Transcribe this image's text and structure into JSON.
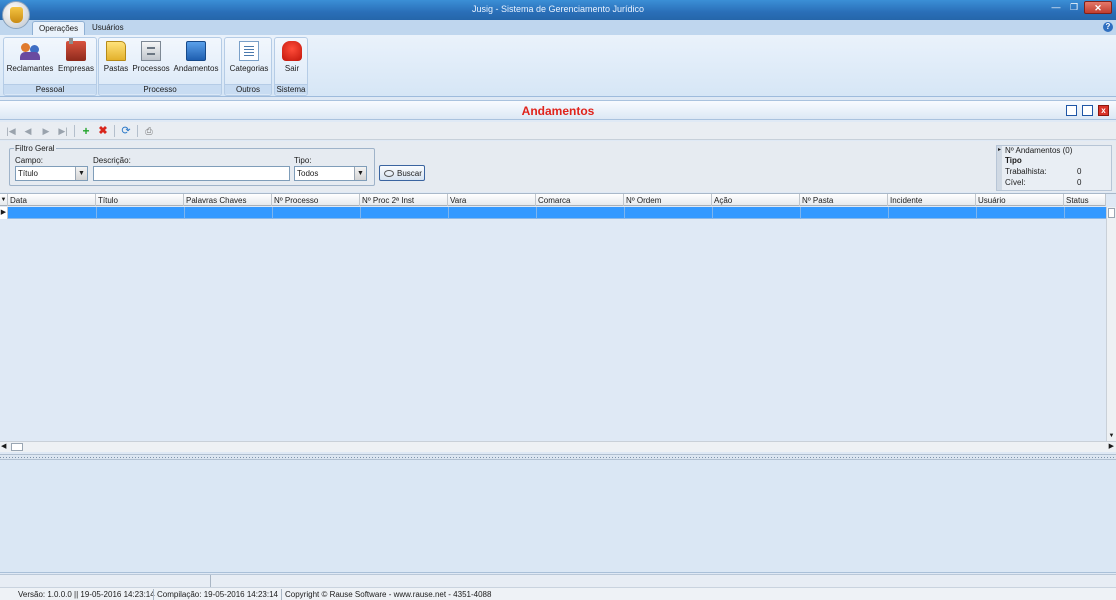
{
  "window": {
    "title": "Jusig - Sistema de Gerenciamento Jurídico",
    "controls": [
      "—",
      "❐",
      "✕"
    ]
  },
  "ribbon": {
    "tabs": [
      {
        "label": "Operações",
        "active": true
      },
      {
        "label": "Usuários",
        "active": false
      }
    ],
    "help_icon": "?",
    "groups": [
      {
        "label": "Pessoal",
        "buttons": [
          {
            "label": "Reclamantes",
            "icon": "people-icon"
          },
          {
            "label": "Empresas",
            "icon": "factory-icon"
          }
        ]
      },
      {
        "label": "Processo",
        "buttons": [
          {
            "label": "Pastas",
            "icon": "folder-icon"
          },
          {
            "label": "Processos",
            "icon": "cabinet-icon"
          },
          {
            "label": "Andamentos",
            "icon": "box-icon"
          }
        ]
      },
      {
        "label": "Outros",
        "buttons": [
          {
            "label": "Categorias",
            "icon": "list-icon"
          }
        ]
      },
      {
        "label": "Sistema",
        "buttons": [
          {
            "label": "Sair",
            "icon": "stop-hand-icon"
          }
        ]
      }
    ]
  },
  "document": {
    "title": "Andamentos",
    "title_color": "#e0231b",
    "close_glyph": "x"
  },
  "toolbar": {
    "first": "|◀",
    "prev": "◀",
    "next": "▶",
    "last": "▶|",
    "add": "+",
    "delete": "✖",
    "refresh": "⟳",
    "print": "⎙"
  },
  "filter": {
    "legend": "Filtro Geral",
    "campo_label": "Campo:",
    "campo_value": "Título",
    "descricao_label": "Descrição:",
    "descricao_value": "",
    "tipo_label": "Tipo:",
    "tipo_value": "Todos",
    "buscar_label": "Buscar"
  },
  "summary": {
    "legend": "Nº Andamentos (0)",
    "tipo_header": "Tipo",
    "rows": [
      {
        "label": "Trabalhista:",
        "value": "0"
      },
      {
        "label": "Cível:",
        "value": "0"
      }
    ]
  },
  "grid": {
    "columns": [
      "Data",
      "Título",
      "Palavras Chaves",
      "Nº Processo",
      "Nº Proc 2ª Inst",
      "Vara",
      "Comarca",
      "Nº Ordem",
      "Ação",
      "Nº Pasta",
      "Incidente",
      "Usuário",
      "Status"
    ],
    "rows": [
      [
        "",
        "",
        "",
        "",
        "",
        "",
        "",
        "",
        "",
        "",
        "",
        "",
        ""
      ]
    ],
    "selected_color": "#3399ff"
  },
  "status": {
    "versao": "Versão: 1.0.0.0 || 19-05-2016 14:23:14",
    "compilacao": "Compilação: 19-05-2016 14:23:14",
    "copyright": "Copyright © Rause Software   -   www.rause.net   -   4351-4088"
  }
}
